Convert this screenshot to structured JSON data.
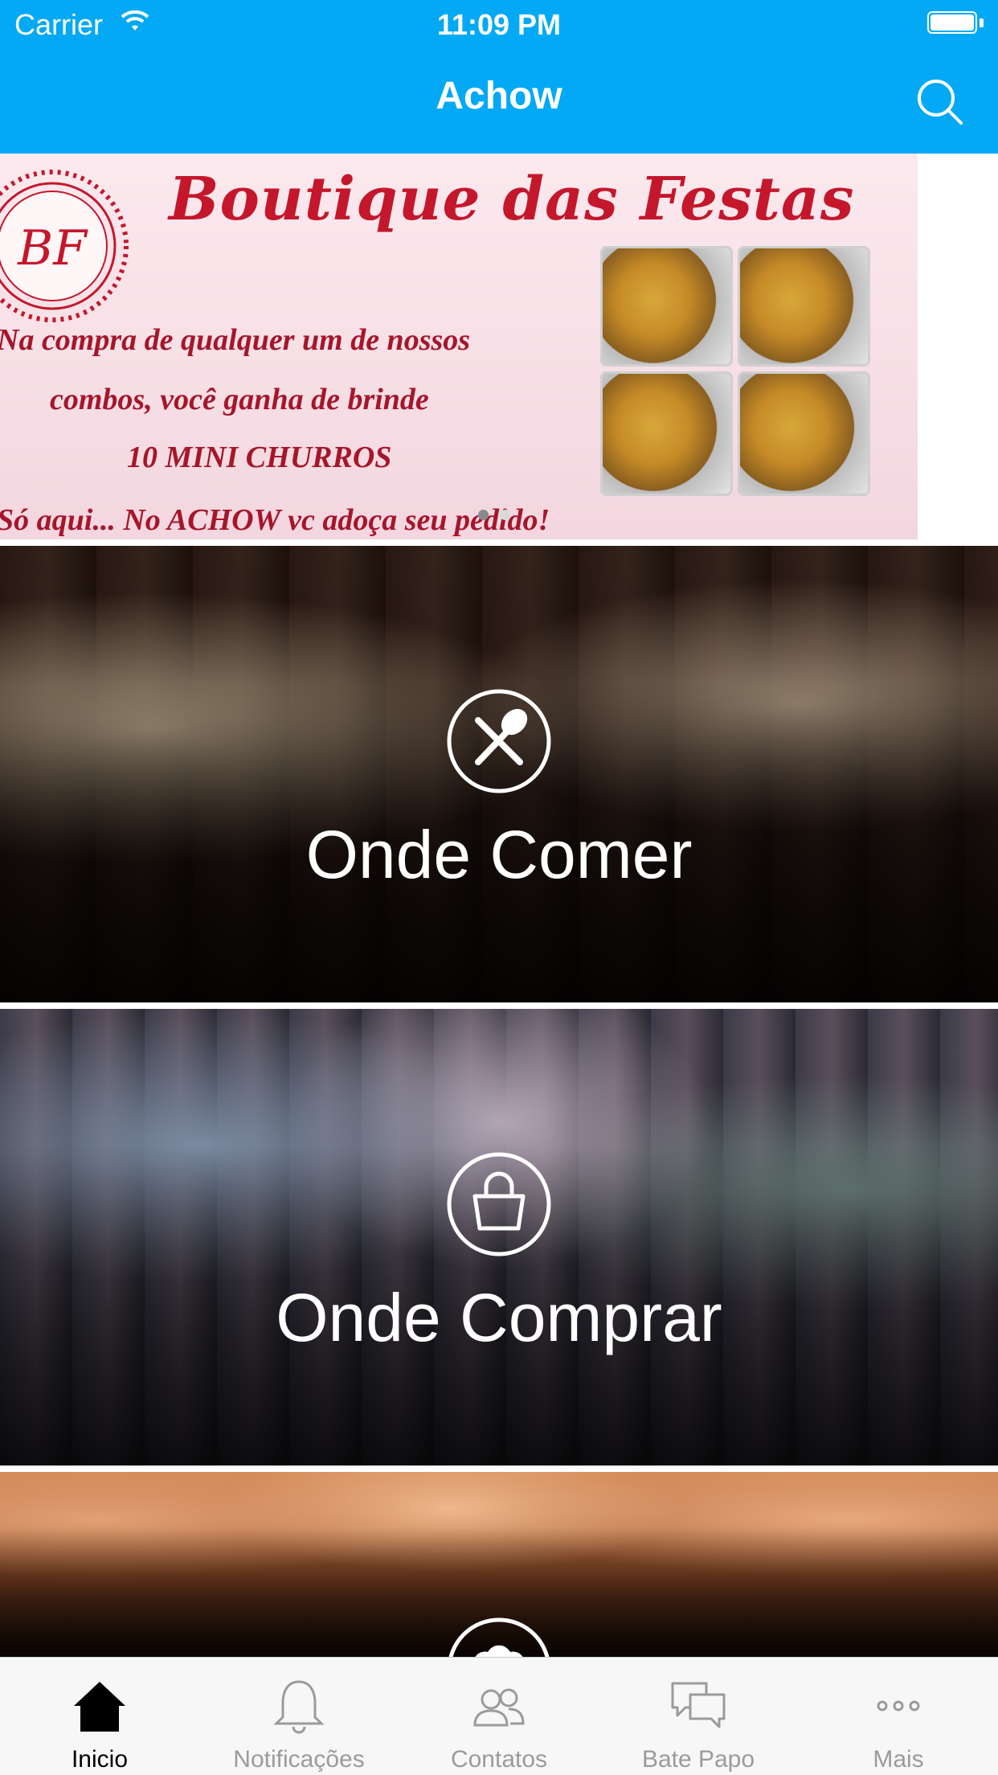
{
  "status_bar": {
    "carrier": "Carrier",
    "time": "11:09 PM"
  },
  "nav": {
    "title": "Achow",
    "search_icon": "search-icon"
  },
  "banner": {
    "logo_text": "BF",
    "title": "Boutique das Festas",
    "line1": "Na compra de qualquer um de nossos",
    "line2": "combos, você ganha de brinde",
    "line3": "10 MINI CHURROS",
    "line4": "Só aqui... No ACHOW vc adoça seu pedido!",
    "page_count": 2,
    "active_page": 1
  },
  "categories": [
    {
      "label": "Onde Comer",
      "icon": "fork-spoon-icon"
    },
    {
      "label": "Onde Comprar",
      "icon": "shopping-bag-icon"
    },
    {
      "label": "",
      "icon": "chef-hat-icon"
    }
  ],
  "tabs": [
    {
      "label": "Inicio",
      "icon": "home-icon",
      "active": true
    },
    {
      "label": "Notificações",
      "icon": "bell-icon",
      "active": false
    },
    {
      "label": "Contatos",
      "icon": "contacts-icon",
      "active": false
    },
    {
      "label": "Bate Papo",
      "icon": "chat-icon",
      "active": false
    },
    {
      "label": "Mais",
      "icon": "more-icon",
      "active": false
    }
  ],
  "colors": {
    "primary": "#03a9f4",
    "banner_red": "#c4172c",
    "tab_inactive": "#9b9b9b"
  }
}
